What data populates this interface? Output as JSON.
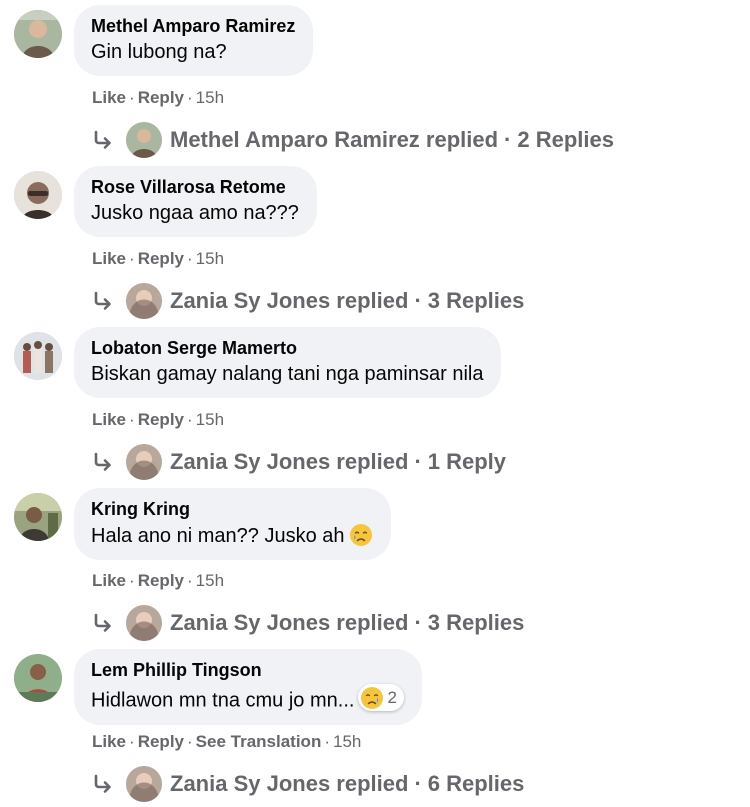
{
  "comments": [
    {
      "author": "Methel Amparo Ramirez",
      "text": "Gin lubong na?",
      "like": "Like",
      "reply": "Reply",
      "time": "15h",
      "replied_by": "Methel Amparo Ramirez replied",
      "reply_count": "2 Replies",
      "colors": {
        "bg": "#a9b6a0",
        "fg": "#6b5a4a"
      }
    },
    {
      "author": "Rose Villarosa Retome",
      "text": "Jusko ngaa amo na???",
      "like": "Like",
      "reply": "Reply",
      "time": "15h",
      "replied_by": "Zania Sy Jones replied",
      "reply_count": "3 Replies",
      "colors": {
        "bg": "#e7e2dc",
        "fg": "#3a2f2a"
      }
    },
    {
      "author": "Lobaton Serge Mamerto",
      "text": "Biskan gamay nalang tani nga paminsar nila",
      "like": "Like",
      "reply": "Reply",
      "time": "15h",
      "replied_by": "Zania Sy Jones replied",
      "reply_count": "1 Reply",
      "colors": {
        "bg": "#dfe3e8",
        "fg": "#b35c4f"
      }
    },
    {
      "author": "Kring Kring",
      "text": "Hala ano ni man?? Jusko ah",
      "emoji": "crying-face-emoji",
      "like": "Like",
      "reply": "Reply",
      "time": "15h",
      "replied_by": "Zania Sy Jones replied",
      "reply_count": "3 Replies",
      "colors": {
        "bg": "#9aa37f",
        "fg": "#3c3a33"
      }
    },
    {
      "author": "Lem Phillip Tingson",
      "text": "Hidlawon mn tna cmu jo mn...",
      "reaction": {
        "icon": "sad-reaction-icon",
        "count": "2"
      },
      "like": "Like",
      "reply": "Reply",
      "translate": "See Translation",
      "time": "15h",
      "replied_by": "Zania Sy Jones replied",
      "reply_count": "6 Replies",
      "colors": {
        "bg": "#8fae8a",
        "fg": "#b2473e"
      }
    }
  ],
  "reply_avatar_colors": {
    "bg": "#b8a79b",
    "fg": "#6e5a50"
  },
  "theme": {
    "bubble": "#f0f2f5",
    "meta": "#65676b",
    "text": "#050505"
  }
}
